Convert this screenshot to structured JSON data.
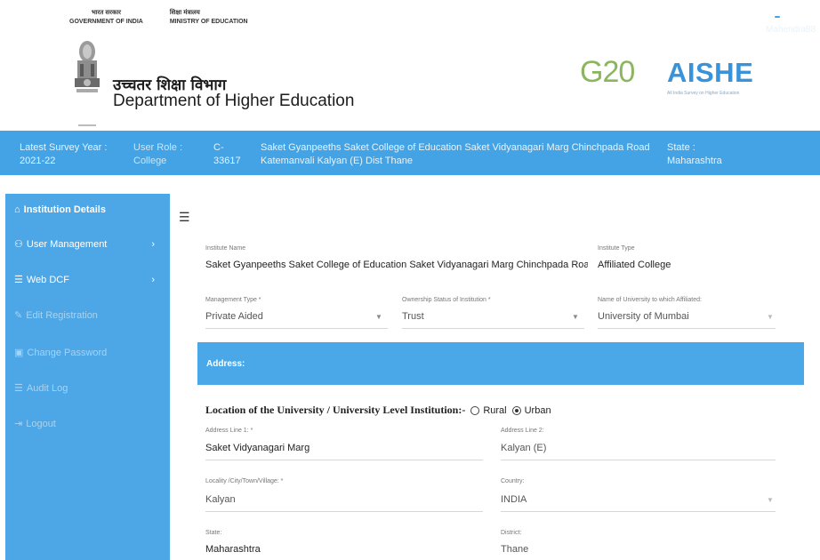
{
  "header": {
    "gov_hindi": "भारत सरकार",
    "gov_english": "GOVERNMENT OF INDIA",
    "ministry_hindi": "शिक्षा मंत्रालय",
    "ministry_english": "MINISTRY OF EDUCATION",
    "dept_hindi": "उच्चतर शिक्षा विभाग",
    "dept_english": "Department of Higher Education",
    "g20_text": "G20",
    "aishe_title": "AISHE",
    "aishe_subtitle": "All India Survey on Higher Education"
  },
  "infobar": {
    "survey_label": "Latest Survey Year :",
    "survey_value": "2021-22",
    "role_label": "User Role :",
    "role_value": "College",
    "code_label": "C-",
    "code_value": "33617",
    "institution_line1": "Saket Gyanpeeths Saket College of Education Saket Vidyanagari Marg Chinchpada Road",
    "institution_line2": "Katemanvali Kalyan (E) Dist Thane",
    "state_label": "State :",
    "state_value": "Maharashtra",
    "username": "Mahendra88"
  },
  "sidebar": {
    "items": [
      {
        "label": "Institution Details",
        "icon": "home-icon"
      },
      {
        "label": "User Management",
        "icon": "users-icon"
      },
      {
        "label": "Web DCF",
        "icon": "list-icon"
      },
      {
        "label": "Edit Registration",
        "icon": "edit-icon"
      },
      {
        "label": "Change Password",
        "icon": "lock-icon"
      },
      {
        "label": "Audit Log",
        "icon": "list-icon"
      },
      {
        "label": "Logout",
        "icon": "logout-icon"
      }
    ],
    "icon_glyphs": [
      "⌂",
      "⚇",
      "☰",
      "✎",
      "🔒",
      "☰",
      "⇥"
    ]
  },
  "form": {
    "institute_name_label": "Institute Name",
    "institute_name_value": "Saket Gyanpeeths Saket College of Education Saket Vidyanagari Marg Chinchpada Road Katemanv.",
    "institute_type_label": "Institute Type",
    "institute_type_value": "Affiliated College",
    "management_type_label": "Management Type *",
    "management_type_value": "Private Aided",
    "ownership_label": "Ownership Status of Institution *",
    "ownership_value": "Trust",
    "university_label": "Name of University to which Affiliated:",
    "university_value": "University of Mumbai",
    "address_section": "Address:",
    "location_label": "Location of the University / University Level Institution:-",
    "rural_label": "Rural",
    "urban_label": "Urban",
    "address1_label": "Address Line 1: *",
    "address1_value": "Saket Vidyanagari Marg",
    "address2_label": "Address Line 2:",
    "address2_value": "Kalyan (E)",
    "locality_label": "Locality /City/Town/Village: *",
    "locality_value": "Kalyan",
    "country_label": "Country:",
    "country_value": "INDIA",
    "state_label": "State:",
    "state_value": "Maharashtra",
    "district_label": "District:",
    "district_value": "Thane"
  },
  "colors": {
    "topbar": "#44a3e4",
    "sidebar": "#4da7e7",
    "aishe_blue": "#3a93d8"
  }
}
